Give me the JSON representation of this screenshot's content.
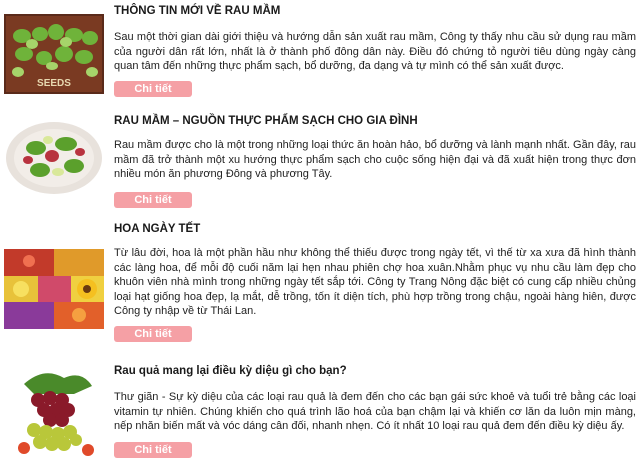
{
  "articles": [
    {
      "title": "THÔNG TIN MỚI VỀ RAU MẦM",
      "description": "   Sau một thời gian dài giới thiệu và hướng dẫn sản xuất rau mầm, Công ty    thấy nhu cầu sử dụng rau mầm của người dân rất lớn, nhất là ở thành phố đông dân này. Điều đó chứng tỏ người tiêu dùng ngày càng quan tâm đến những thực phẩm sạch, bổ dưỡng, đa dạng và tự mình có thể sản xuất được.",
      "image_text": "SEEDS",
      "button_label": "Chi tiết"
    },
    {
      "title": "RAU MẦM – NGUỒN THỰC PHẨM SẠCH CHO GIA ĐÌNH",
      "description": "Rau mầm được cho là một trong những loại thức ăn hoàn hảo, bổ dưỡng và lành mạnh nhất. Gần đây, rau mầm đã trở thành một xu hướng thực phẩm sạch cho cuộc sống hiện đại và đã xuất hiện trong thực đơn nhiều món ăn phương Đông và phương Tây.",
      "button_label": "Chi tiết"
    },
    {
      "title": "HOA NGÀY TẾT",
      "description": "Từ lâu đời, hoa là một phần hầu như không thể thiếu được trong ngày tết, vì thế từ xa xưa đã hình thành các làng hoa, để mỗi độ cuối năm lại hẹn nhau phiên chợ hoa xuân.Nhằm phục vụ nhu cầu làm đẹp cho khuôn viên nhà mình trong những ngày tết sắp tới. Công ty Trang Nông đặc biệt có cung cấp nhiều chủng loại hạt giống hoa đẹp, lạ mắt, dễ trồng, tốn ít diện tích, phù hợp trồng trong chậu, ngoài hàng hiên, được Công ty nhập về từ Thái Lan.",
      "button_label": "Chi tiết"
    },
    {
      "title": "Rau quả mang lại điều kỳ diệu gì cho bạn?",
      "description": "Thư giãn - Sự kỳ diệu của các loại rau quả là đem đến cho các bạn gái sức khoẻ và tuổi trẻ bằng các loại vitamin tự nhiên. Chúng khiến cho quá trình lão hoá của bạn chậm lại và khiến cơ lăn da luôn mịn màng, nếp nhăn biến mất và vóc dáng cân đối, nhanh nhẹn. Có ít nhất 10 loại rau quả đem đến điều kỳ diệu ấy.",
      "button_label": "Chi tiết"
    }
  ],
  "colors": {
    "button_bg": "#f5a0a5",
    "button_text": "#ffffff",
    "title_text": "#1a1a1a"
  }
}
